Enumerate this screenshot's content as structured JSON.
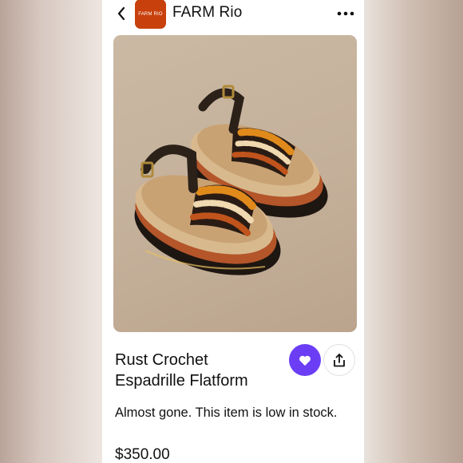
{
  "header": {
    "back_icon": "chevron-left-icon",
    "store_logo_text": "FARM RIO",
    "store_name": "FARM Rio",
    "more_icon": "more-horizontal-icon"
  },
  "product": {
    "image_alt": "Rust Crochet Espadrille Flatform sandals",
    "title_line1": "Rust Crochet",
    "title_line2": "Espadrille Flatform",
    "stock_note": "Almost gone. This item is low in stock.",
    "price": "$350.00"
  },
  "actions": {
    "favorite_icon": "heart-icon",
    "share_icon": "share-icon"
  },
  "colors": {
    "brand_logo": "#c8400c",
    "favorite_button": "#6b3ef5",
    "image_background": "#c4b09a"
  }
}
